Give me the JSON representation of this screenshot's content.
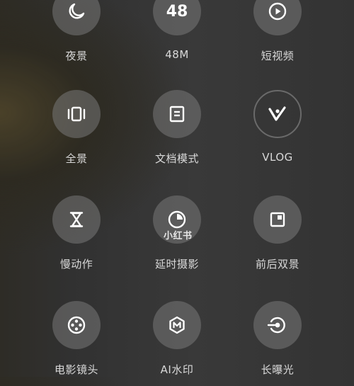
{
  "modes": [
    {
      "label": "夜景",
      "icon": "moon-icon"
    },
    {
      "label": "48M",
      "icon": "48-badge-icon",
      "icon_text": "48"
    },
    {
      "label": "短视频",
      "icon": "play-circle-icon"
    },
    {
      "label": "全景",
      "icon": "panorama-icon"
    },
    {
      "label": "文档模式",
      "icon": "document-icon"
    },
    {
      "label": "VLOG",
      "icon": "vlog-v-icon"
    },
    {
      "label": "慢动作",
      "icon": "hourglass-icon"
    },
    {
      "label": "延时摄影",
      "icon": "timer-icon"
    },
    {
      "label": "前后双景",
      "icon": "dual-view-icon"
    },
    {
      "label": "电影镜头",
      "icon": "film-reel-icon"
    },
    {
      "label": "AI水印",
      "icon": "ai-watermark-icon"
    },
    {
      "label": "长曝光",
      "icon": "long-exposure-icon"
    }
  ],
  "watermark": "小红书",
  "colors": {
    "icon": "#ffffff",
    "circle": "#6e6e6e",
    "label": "#d9d9d9",
    "vlog_ring": "#8a8a8a"
  }
}
